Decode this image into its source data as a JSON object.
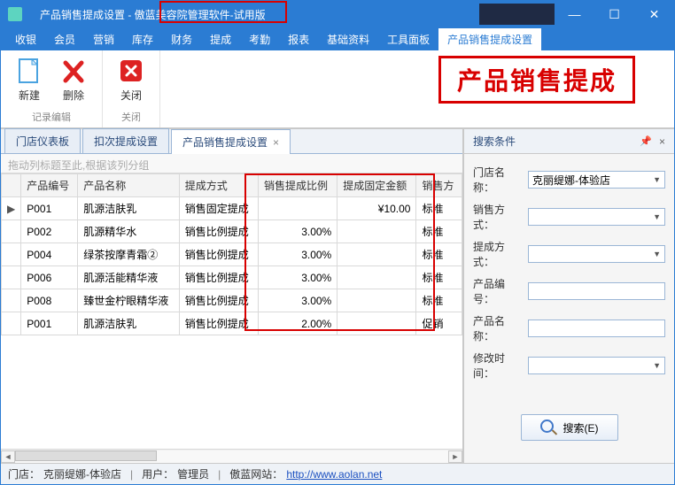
{
  "window": {
    "title": "产品销售提成设置 - 傲蓝美容院管理软件-试用版"
  },
  "menu": {
    "items": [
      "收银",
      "会员",
      "营销",
      "库存",
      "财务",
      "提成",
      "考勤",
      "报表",
      "基础资料",
      "工具面板",
      "产品销售提成设置"
    ],
    "activeIndex": 10
  },
  "ribbon": {
    "group1": {
      "label": "记录编辑",
      "new": "新建",
      "delete": "删除"
    },
    "group2": {
      "label": "关闭",
      "close": "关闭"
    },
    "banner": "产品销售提成"
  },
  "doctabs": {
    "items": [
      "门店仪表板",
      "扣次提成设置",
      "产品销售提成设置"
    ],
    "activeIndex": 2,
    "closeGlyph": "×"
  },
  "grid": {
    "groupHint": "拖动列标题至此,根据该列分组",
    "columns": [
      "产品编号",
      "产品名称",
      "提成方式",
      "销售提成比例",
      "提成固定金额",
      "销售方"
    ],
    "rows": [
      {
        "mark": "▶",
        "code": "P001",
        "name": "肌源洁肤乳",
        "method": "销售固定提成",
        "ratio": "",
        "fixed": "¥10.00",
        "sale": "标准"
      },
      {
        "mark": "",
        "code": "P002",
        "name": "肌源精华水",
        "method": "销售比例提成",
        "ratio": "3.00%",
        "fixed": "",
        "sale": "标准"
      },
      {
        "mark": "",
        "code": "P004",
        "name": "绿茶按摩青霜②",
        "method": "销售比例提成",
        "ratio": "3.00%",
        "fixed": "",
        "sale": "标准"
      },
      {
        "mark": "",
        "code": "P006",
        "name": "肌源活能精华液",
        "method": "销售比例提成",
        "ratio": "3.00%",
        "fixed": "",
        "sale": "标准"
      },
      {
        "mark": "",
        "code": "P008",
        "name": "臻世金柠眼精华液",
        "method": "销售比例提成",
        "ratio": "3.00%",
        "fixed": "",
        "sale": "标准"
      },
      {
        "mark": "",
        "code": "P001",
        "name": "肌源洁肤乳",
        "method": "销售比例提成",
        "ratio": "2.00%",
        "fixed": "",
        "sale": "促销"
      }
    ]
  },
  "search": {
    "title": "搜索条件",
    "fields": {
      "store": {
        "label": "门店名称：",
        "value": "克丽缇娜-体验店"
      },
      "saleMethod": {
        "label": "销售方式：",
        "value": ""
      },
      "commMethod": {
        "label": "提成方式：",
        "value": ""
      },
      "code": {
        "label": "产品编号：",
        "value": ""
      },
      "name": {
        "label": "产品名称：",
        "value": ""
      },
      "modified": {
        "label": "修改时间：",
        "value": ""
      }
    },
    "button": "搜索(E)"
  },
  "status": {
    "storeLabel": "门店：",
    "storeValue": "克丽缇娜-体验店",
    "userLabel": "用户：",
    "userValue": "管理员",
    "siteLabel": "傲蓝网站：",
    "siteUrl": "http://www.aolan.net"
  }
}
